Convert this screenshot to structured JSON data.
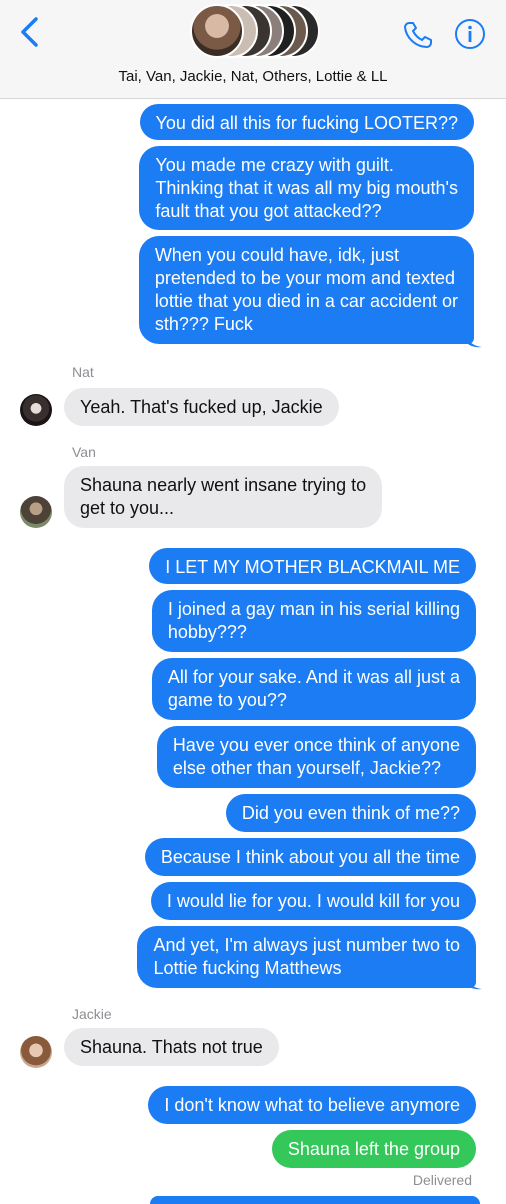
{
  "header": {
    "group_name": "Tai, Van, Jackie, Nat, Others, Lottie & LL",
    "icons": {
      "back": "chevron-left-icon",
      "phone": "phone-icon",
      "info": "info-icon"
    },
    "accent": "#1b7cf4"
  },
  "messages": {
    "m1": "You did all this for fucking LOOTER??",
    "m2": [
      "You made me crazy with guilt.",
      "Thinking that it was all my big mouth's",
      "fault that you got attacked??"
    ],
    "m3": [
      "When you could have, idk, just",
      "pretended to be your mom and texted",
      "lottie that you died in a car accident or",
      "sth??? Fuck"
    ],
    "nat_name": "Nat",
    "m4": "Yeah. That's fucked up, Jackie",
    "van_name": "Van",
    "m5": [
      "Shauna nearly went insane trying to",
      "get to you..."
    ],
    "m6": "I LET MY MOTHER BLACKMAIL ME",
    "m7": [
      "I joined a gay man in his serial killing",
      "hobby???"
    ],
    "m8": [
      "All for your sake. And it was all just a",
      "game to you??"
    ],
    "m9": [
      "Have you ever once think of anyone",
      "else other than yourself, Jackie??"
    ],
    "m10": "Did you even think of me??",
    "m11": "Because I think about you all the time",
    "m12": "I would lie for you. I would kill for you",
    "m13": [
      "And yet, I'm always just number two to",
      "Lottie fucking Matthews"
    ],
    "jackie_name": "Jackie",
    "m14": "Shauna. Thats not true",
    "m15": "I don't know what to believe anymore",
    "m16": "Shauna left the group",
    "status": "Delivered"
  },
  "colors": {
    "outgoing": "#1b7cf4",
    "incoming": "#e9e9eb",
    "system": "#34c759",
    "meta": "#8e8e93"
  }
}
